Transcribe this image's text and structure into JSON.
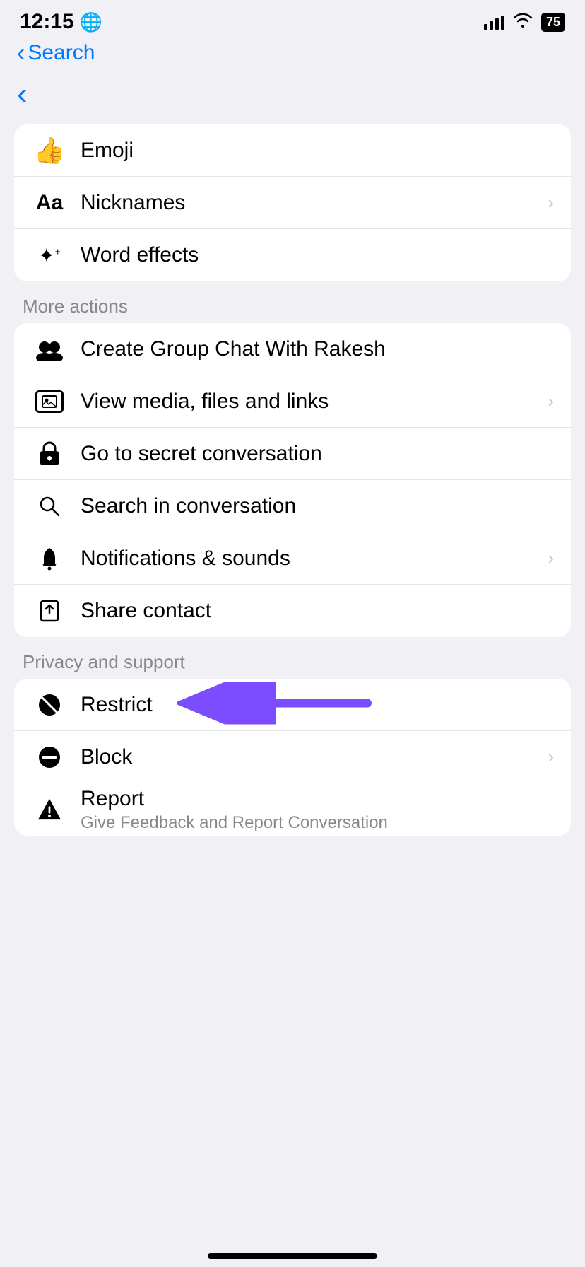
{
  "statusBar": {
    "time": "12:15",
    "battery": "75"
  },
  "nav": {
    "backLabel": "Search",
    "backArrow": "‹"
  },
  "sections": [
    {
      "label": "",
      "items": [
        {
          "id": "emoji",
          "icon": "👍",
          "iconType": "emoji",
          "label": "Emoji",
          "hasChevron": false
        },
        {
          "id": "nicknames",
          "icon": "Aa",
          "iconType": "text",
          "label": "Nicknames",
          "hasChevron": true
        },
        {
          "id": "word-effects",
          "icon": "✦",
          "iconType": "weffect",
          "label": "Word effects",
          "hasChevron": false
        }
      ]
    },
    {
      "label": "More actions",
      "items": [
        {
          "id": "create-group",
          "icon": "👥",
          "iconType": "group",
          "label": "Create Group Chat With Rakesh",
          "hasChevron": false
        },
        {
          "id": "view-media",
          "icon": "media",
          "iconType": "media",
          "label": "View media, files and links",
          "hasChevron": true
        },
        {
          "id": "secret-conversation",
          "icon": "🔒",
          "iconType": "lock",
          "label": "Go to secret conversation",
          "hasChevron": false
        },
        {
          "id": "search-conversation",
          "icon": "🔍",
          "iconType": "search",
          "label": "Search in conversation",
          "hasChevron": false
        },
        {
          "id": "notifications",
          "icon": "🔔",
          "iconType": "bell",
          "label": "Notifications & sounds",
          "hasChevron": true
        },
        {
          "id": "share-contact",
          "icon": "share",
          "iconType": "share",
          "label": "Share contact",
          "hasChevron": false
        }
      ]
    },
    {
      "label": "Privacy and support",
      "items": [
        {
          "id": "restrict",
          "icon": "restrict",
          "iconType": "restrict",
          "label": "Restrict",
          "hasChevron": false,
          "hasArrow": true
        },
        {
          "id": "block",
          "icon": "⊖",
          "iconType": "block",
          "label": "Block",
          "hasChevron": true
        },
        {
          "id": "report",
          "icon": "⚠",
          "iconType": "warning",
          "label": "Report",
          "sublabel": "Give Feedback and Report Conversation",
          "hasChevron": false
        }
      ]
    }
  ],
  "homeIndicator": true,
  "colors": {
    "purple": "#7c4dff",
    "blue": "#007aff",
    "gray": "#888888",
    "separator": "#e5e5ea"
  }
}
